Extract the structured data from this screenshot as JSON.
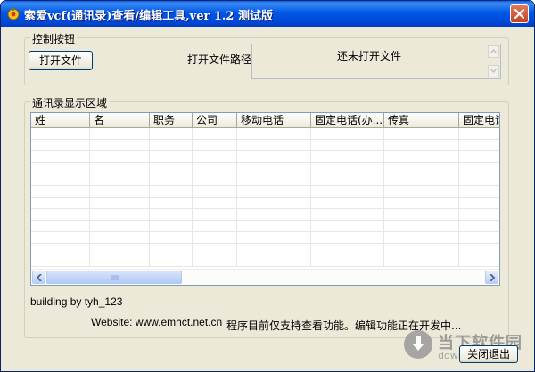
{
  "window": {
    "title": "索爱vcf(通讯录)查看/编辑工具,ver 1.2 测试版",
    "icon": "app-icon",
    "close_icon": "close-icon"
  },
  "control_group": {
    "legend": "控制按钮",
    "open_button": "打开文件",
    "path_label": "打开文件路径:",
    "path_value": "还未打开文件"
  },
  "display_group": {
    "legend": "通讯录显示区域",
    "columns": [
      "姓",
      "名",
      "职务",
      "公司",
      "移动电话",
      "固定电话(办...",
      "传真",
      "固定电话"
    ],
    "rows": []
  },
  "footer": {
    "credit": "building by tyh_123",
    "website": "Website: www.emhct.net.cn",
    "status": "程序目前仅支持查看功能。编辑功能正在开发中...",
    "exit_button": "关闭退出"
  },
  "watermark": {
    "title": "当下软件园",
    "domain": "downxia.com"
  },
  "colors": {
    "titlebar": "#0058e6",
    "window_bg": "#ece9d8",
    "grid_border": "#7f9db9"
  }
}
